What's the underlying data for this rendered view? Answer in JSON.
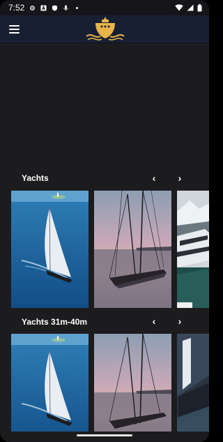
{
  "status_bar": {
    "time": "7:52"
  },
  "sections": [
    {
      "title": "Yachts",
      "prev_label": "‹",
      "next_label": "›",
      "cards": [
        {
          "name": "sailing-yacht-aerial"
        },
        {
          "name": "sailing-yacht-sunset"
        },
        {
          "name": "motor-yacht-fjord"
        }
      ]
    },
    {
      "title": "Yachts 31m-40m",
      "prev_label": "‹",
      "next_label": "›",
      "cards": [
        {
          "name": "sailing-yacht-aerial"
        },
        {
          "name": "sailing-yacht-sunset"
        },
        {
          "name": "motor-yacht-dark"
        }
      ]
    }
  ],
  "colors": {
    "background": "#1c1c1e",
    "app_bar": "#172032",
    "logo_gold": "#e8b54a"
  }
}
